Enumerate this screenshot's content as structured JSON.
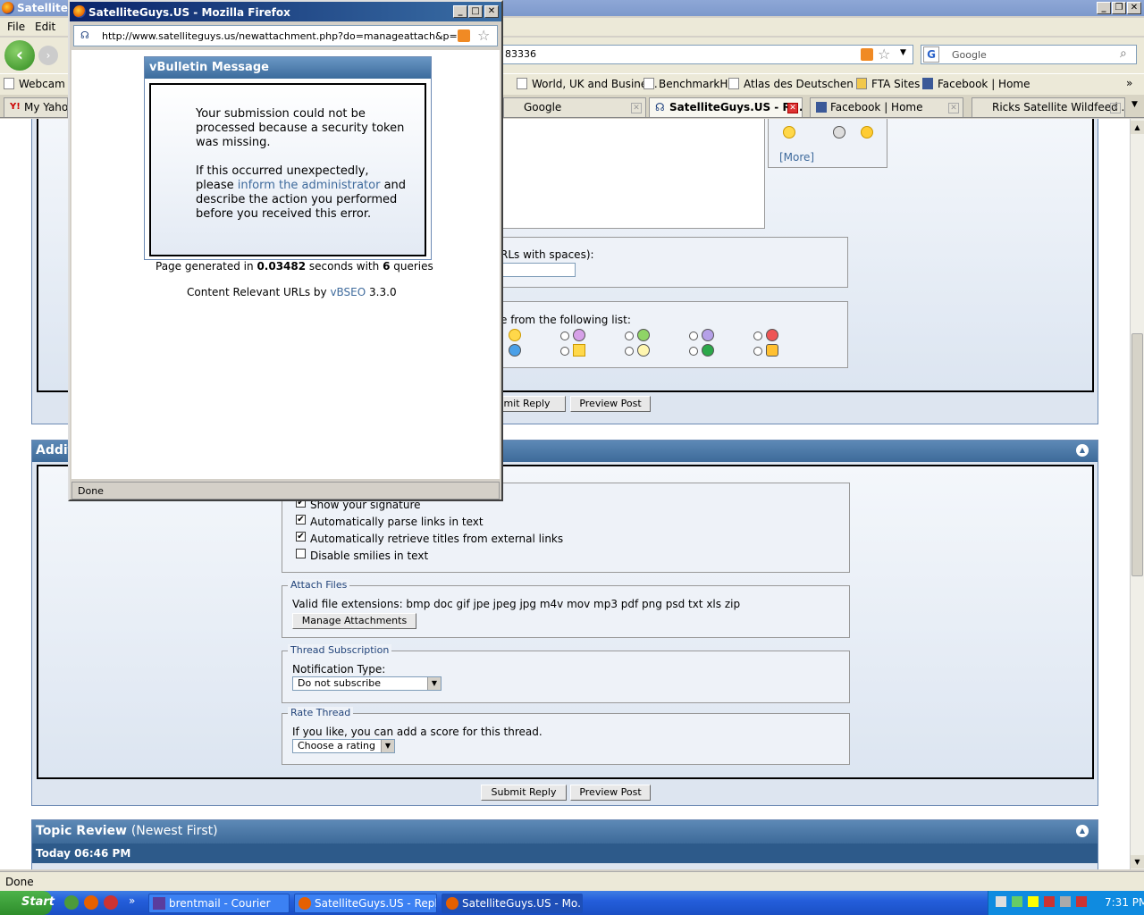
{
  "main_window": {
    "title": "SatelliteG",
    "menu": [
      "File",
      "Edit"
    ],
    "address_tail": "83336",
    "search_placeholder": "Google",
    "bookmarks": [
      "Webcam fr",
      "World, UK and Busine...",
      "BenchmarkHQ",
      "Atlas des Deutschen ...",
      "FTA Sites",
      "Facebook | Home"
    ],
    "tabs": [
      {
        "label": "My Yahoo",
        "active": false
      },
      {
        "label": "Google",
        "active": false
      },
      {
        "label": "SatelliteGuys.US - R...",
        "active": true
      },
      {
        "label": "Facebook | Home",
        "active": false
      },
      {
        "label": "Ricks Satellite Wildfeed ...",
        "active": false
      }
    ],
    "status": "Done"
  },
  "page": {
    "smilies_more": "[More]",
    "urls_label_tail": "RLs with spaces):",
    "icons_label_tail": "e from the following list:",
    "submit_reply_top": "mit Reply",
    "preview_post_top": "Preview Post",
    "additional_head": "Additi",
    "options": {
      "items": [
        {
          "label": "Show your signature",
          "checked": true
        },
        {
          "label": "Automatically parse links in text",
          "checked": true
        },
        {
          "label": "Automatically retrieve titles from external links",
          "checked": true
        },
        {
          "label": "Disable smilies in text",
          "checked": false
        }
      ]
    },
    "attach": {
      "legend": "Attach Files",
      "extensions": "Valid file extensions: bmp doc gif jpe jpeg jpg m4v mov mp3 pdf png psd txt xls zip",
      "button": "Manage Attachments"
    },
    "subscription": {
      "legend": "Thread Subscription",
      "label": "Notification Type:",
      "value": "Do not subscribe"
    },
    "rate": {
      "legend": "Rate Thread",
      "label": "If you like, you can add a score for this thread.",
      "value": "Choose a rating"
    },
    "submit_reply": "Submit Reply",
    "preview_post": "Preview Post",
    "topic_review": "Topic Review",
    "topic_review_sub": "(Newest First)",
    "topic_date": "Today 06:46 PM"
  },
  "popup": {
    "title": "SatelliteGuys.US - Mozilla Firefox",
    "url": "http://www.satelliteguys.us/newattachment.php?do=manageattach&p=",
    "message_title": "vBulletin Message",
    "message_p1": "Your submission could not be processed because a security token was missing.",
    "message_p2a": "If this occurred unexpectedly, please",
    "message_link": "inform the administrator",
    "message_p2b": "and describe the action you performed before you received this error.",
    "page_generated_a": "Page generated in",
    "page_generated_time": "0.03482",
    "page_generated_b": "seconds with",
    "page_generated_q": "6",
    "page_generated_c": "queries",
    "seo_a": "Content Relevant URLs by",
    "seo_link": "vBSEO",
    "seo_b": "3.3.0",
    "status": "Done"
  },
  "taskbar": {
    "start": "Start",
    "tasks": [
      {
        "label": "brentmail - Courier",
        "active": false
      },
      {
        "label": "SatelliteGuys.US - Reply ...",
        "active": false
      },
      {
        "label": "SatelliteGuys.US - Mo...",
        "active": true
      }
    ],
    "clock": "7:31 PM"
  }
}
